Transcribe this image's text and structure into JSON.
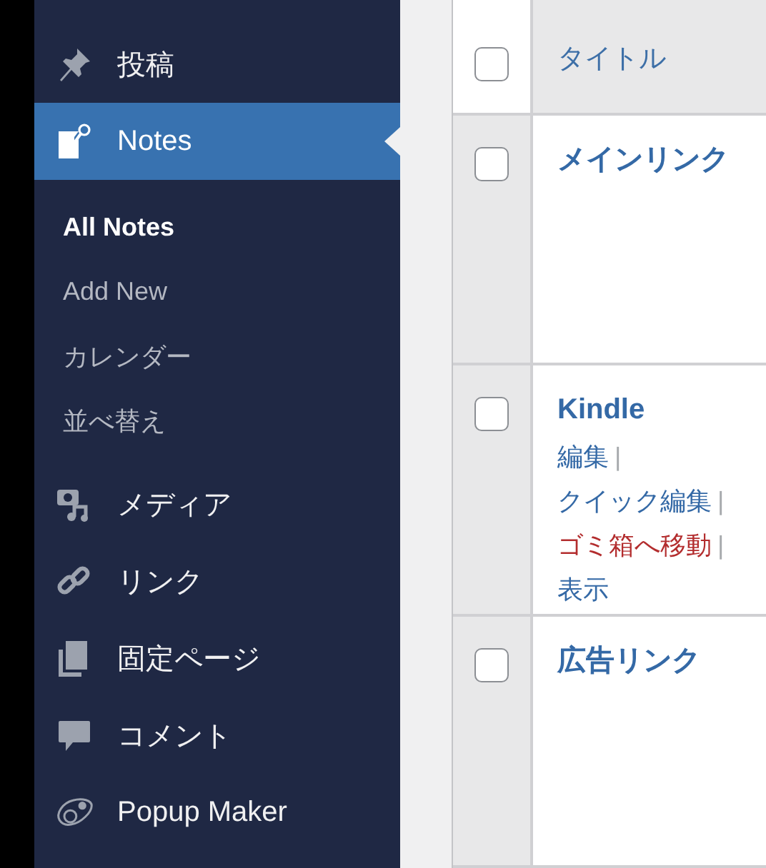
{
  "sidebar": {
    "items": [
      {
        "label": "投稿",
        "selected": false
      },
      {
        "label": "Notes",
        "selected": true,
        "children": [
          {
            "label": "All Notes",
            "selected": true
          },
          {
            "label": "Add New",
            "selected": false
          },
          {
            "label": "カレンダー",
            "selected": false
          },
          {
            "label": "並べ替え",
            "selected": false
          }
        ]
      },
      {
        "label": "メディア",
        "selected": false
      },
      {
        "label": "リンク",
        "selected": false
      },
      {
        "label": "固定ページ",
        "selected": false
      },
      {
        "label": "コメント",
        "selected": false
      },
      {
        "label": "Popup Maker",
        "selected": false
      }
    ]
  },
  "table": {
    "header": {
      "checked": false,
      "title": "タイトル"
    },
    "rows": [
      {
        "checked": false,
        "title": "メインリンク"
      },
      {
        "checked": false,
        "title": "Kindle",
        "actions": [
          {
            "label": "編集",
            "kind": "link",
            "separator": "|"
          },
          {
            "label": "クイック編集",
            "kind": "link",
            "separator": "|"
          },
          {
            "label": "ゴミ箱へ移動",
            "kind": "trash",
            "separator": "|"
          },
          {
            "label": "表示",
            "kind": "link"
          }
        ]
      },
      {
        "checked": false,
        "title": "広告リンク"
      }
    ]
  }
}
